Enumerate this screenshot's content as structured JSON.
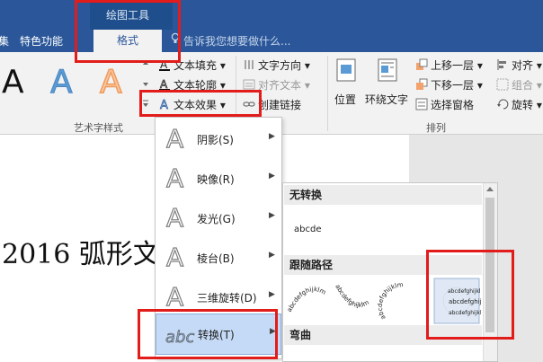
{
  "topbar": {
    "context_group": "绘图工具",
    "tabs": [
      "集",
      "特色功能"
    ],
    "active_tab": "格式",
    "tell_me": "告诉我您想要做什么..."
  },
  "ribbon": {
    "wordart": {
      "samples": [
        "A",
        "A",
        "A"
      ],
      "group_label": "艺术字样式",
      "text_fill": "文本填充",
      "text_outline": "文本轮廓",
      "text_effects": "文本效果",
      "colors": {
        "black": "#111111",
        "blue": "#5b9bd5",
        "orange": "#f4a26b"
      }
    },
    "text": {
      "direction": "文字方向",
      "align": "对齐文本",
      "link": "创建链接"
    },
    "arrange": {
      "position": "位置",
      "wrap": "环绕文字",
      "bring_forward": "上移一层",
      "send_backward": "下移一层",
      "selection_pane": "选择窗格",
      "align": "对齐",
      "group": "组合",
      "rotate": "旋转",
      "group_label": "排列"
    }
  },
  "document": {
    "heading": "2016 弧形文"
  },
  "menu": {
    "items": [
      {
        "label": "阴影(S)",
        "glyph": "A"
      },
      {
        "label": "映像(R)",
        "glyph": "A"
      },
      {
        "label": "发光(G)",
        "glyph": "A"
      },
      {
        "label": "棱台(B)",
        "glyph": "A"
      },
      {
        "label": "三维旋转(D)",
        "glyph": "A"
      },
      {
        "label": "转换(T)",
        "glyph": "abc"
      }
    ]
  },
  "submenu": {
    "no_transform": "无转换",
    "no_transform_sample": "abcde",
    "follow_path": "跟随路径",
    "arc_text": "abcdefghijklm",
    "warp": "弯曲"
  },
  "colors": {
    "accent": "#2b579a",
    "highlight": "#e21b1b",
    "selected": "#c5daf6"
  }
}
